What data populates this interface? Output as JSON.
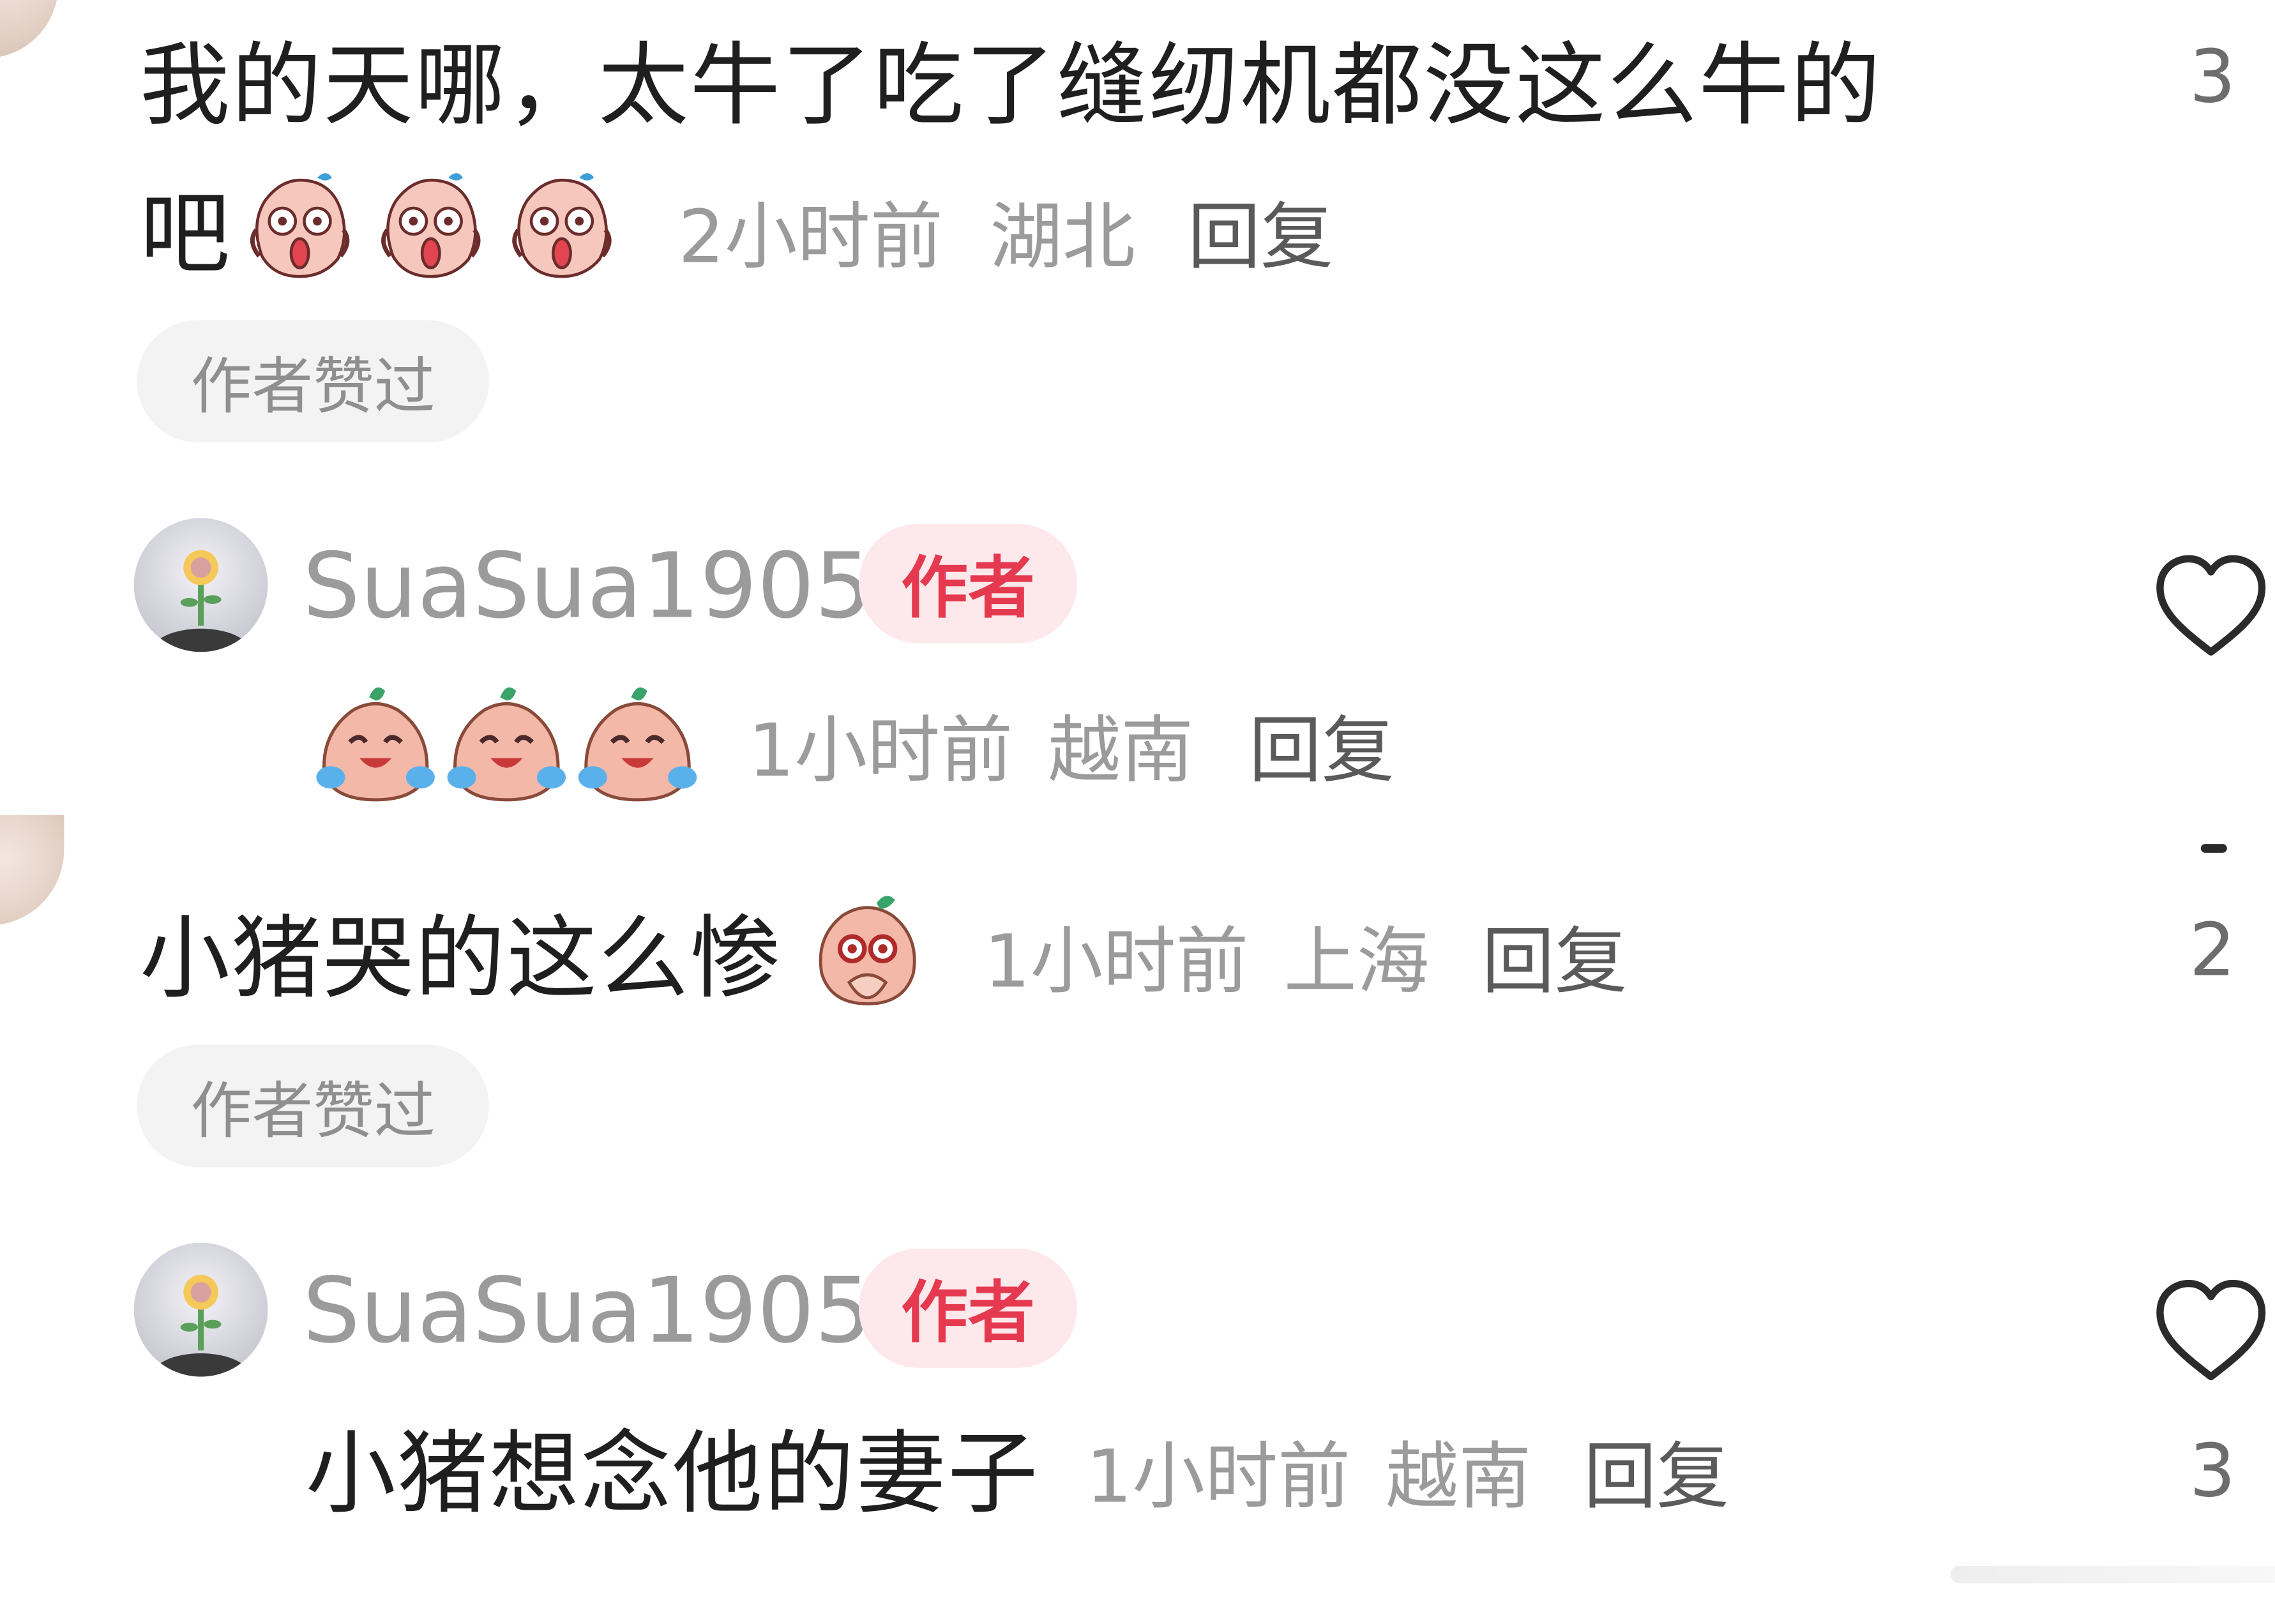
{
  "comment1": {
    "text_line1": "我的天哪，太牛了吃了缝纫机都没这么牛的",
    "text_line2": "吧",
    "emojis": [
      "scream-emoji",
      "scream-emoji",
      "scream-emoji"
    ],
    "time": "2小时前",
    "location": "湖北",
    "reply_label": "回复",
    "like_count": "3",
    "author_liked_label": "作者赞过"
  },
  "reply1": {
    "username": "SuaSua1905",
    "badge": "作者",
    "emojis": [
      "laugh-cry-emoji",
      "laugh-cry-emoji",
      "laugh-cry-emoji"
    ],
    "time": "1小时前",
    "location": "越南",
    "reply_label": "回复",
    "like_icon": "heart-outline-icon"
  },
  "comment2": {
    "text": "小猪哭的这么惨",
    "emojis": [
      "pleading-emoji"
    ],
    "time": "1小时前",
    "location": "上海",
    "reply_label": "回复",
    "like_count": "2",
    "author_liked_label": "作者赞过"
  },
  "reply2": {
    "username": "SuaSua1905",
    "badge": "作者",
    "text": "小猪想念他的妻子",
    "time": "1小时前",
    "location": "越南",
    "reply_label": "回复",
    "like_count": "3",
    "like_icon": "heart-outline-icon"
  },
  "colors": {
    "background": "#ffffff",
    "text_primary": "#1f1f1f",
    "text_meta": "#9b9b9b",
    "author_badge_bg": "#fde9ec",
    "author_badge_text": "#e53950",
    "chip_bg": "#f3f3f3"
  }
}
